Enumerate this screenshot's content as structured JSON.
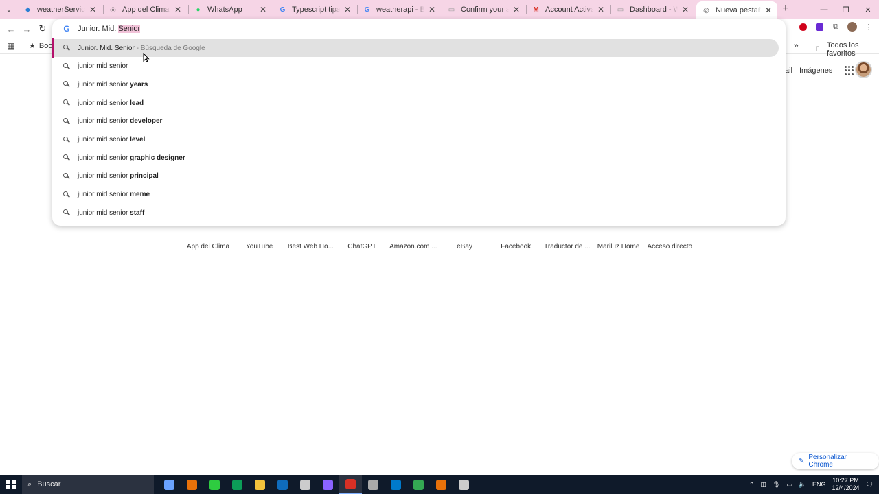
{
  "tabs": [
    {
      "title": "weatherService.ts - W",
      "favicon": "vscode-icon",
      "color": "#2a7fd4"
    },
    {
      "title": "App del Clima",
      "favicon": "globe-icon",
      "color": "#555555"
    },
    {
      "title": "WhatsApp",
      "favicon": "whatsapp-icon",
      "color": "#25d366"
    },
    {
      "title": "Typescript tipado est",
      "favicon": "google-icon",
      "color": "#4285f4"
    },
    {
      "title": "weatherapi - Buscar c",
      "favicon": "google-icon",
      "color": "#4285f4"
    },
    {
      "title": "Confirm your accoun",
      "favicon": "page-icon",
      "color": "#999999"
    },
    {
      "title": "Account Activation -",
      "favicon": "gmail-icon",
      "color": "#d93025"
    },
    {
      "title": "Dashboard - Weathe",
      "favicon": "page-icon",
      "color": "#999999"
    },
    {
      "title": "Nueva pestaña",
      "favicon": "chrome-icon",
      "color": "#555555"
    }
  ],
  "omnibox": {
    "typed": "Junior. Mid. ",
    "selected": "Senior"
  },
  "suggestions": [
    {
      "plain": "Junior. Mid. Senior",
      "bold": "",
      "suffix": " - Búsqueda de Google"
    },
    {
      "plain": "junior mid senior",
      "bold": "",
      "suffix": ""
    },
    {
      "plain": "junior mid senior ",
      "bold": "years",
      "suffix": ""
    },
    {
      "plain": "junior mid senior ",
      "bold": "lead",
      "suffix": ""
    },
    {
      "plain": "junior mid senior ",
      "bold": "developer",
      "suffix": ""
    },
    {
      "plain": "junior mid senior ",
      "bold": "level",
      "suffix": ""
    },
    {
      "plain": "junior mid senior ",
      "bold": "graphic designer",
      "suffix": ""
    },
    {
      "plain": "junior mid senior ",
      "bold": "principal",
      "suffix": ""
    },
    {
      "plain": "junior mid senior ",
      "bold": "meme",
      "suffix": ""
    },
    {
      "plain": "junior mid senior ",
      "bold": "staff",
      "suffix": ""
    }
  ],
  "bookmarks": {
    "first": "Book",
    "all": "Todos los favoritos"
  },
  "ntp": {
    "gmail": "Gmail",
    "images": "Imágenes"
  },
  "shortcuts": [
    {
      "label": "App del Clima",
      "color": "#e8710a"
    },
    {
      "label": "YouTube",
      "color": "#ff0000"
    },
    {
      "label": "Best Web Ho...",
      "color": "#cfd8dc"
    },
    {
      "label": "ChatGPT",
      "color": "#555555"
    },
    {
      "label": "Amazon.com ...",
      "color": "#ff9900"
    },
    {
      "label": "eBay",
      "color": "#e53238"
    },
    {
      "label": "Facebook",
      "color": "#1877f2"
    },
    {
      "label": "Traductor de ...",
      "color": "#4285f4"
    },
    {
      "label": "Mariluz Home",
      "color": "#00a8e8"
    },
    {
      "label": "Acceso directo",
      "color": "#888888"
    }
  ],
  "customize_label": "Personalizar Chrome",
  "taskbar": {
    "search_label": "Buscar",
    "apps": [
      "#6aa3ff",
      "#e8710a",
      "#2ecc40",
      "#0c9d58",
      "#f3c23c",
      "#0f6cbd",
      "#cccccc",
      "#8a63ff",
      "#d93025",
      "#aaaaaa",
      "#007acc",
      "#34a853",
      "#e8710a",
      "#cccccc"
    ],
    "lang": "ENG",
    "time": "10:27 PM",
    "date": "12/4/2024"
  }
}
